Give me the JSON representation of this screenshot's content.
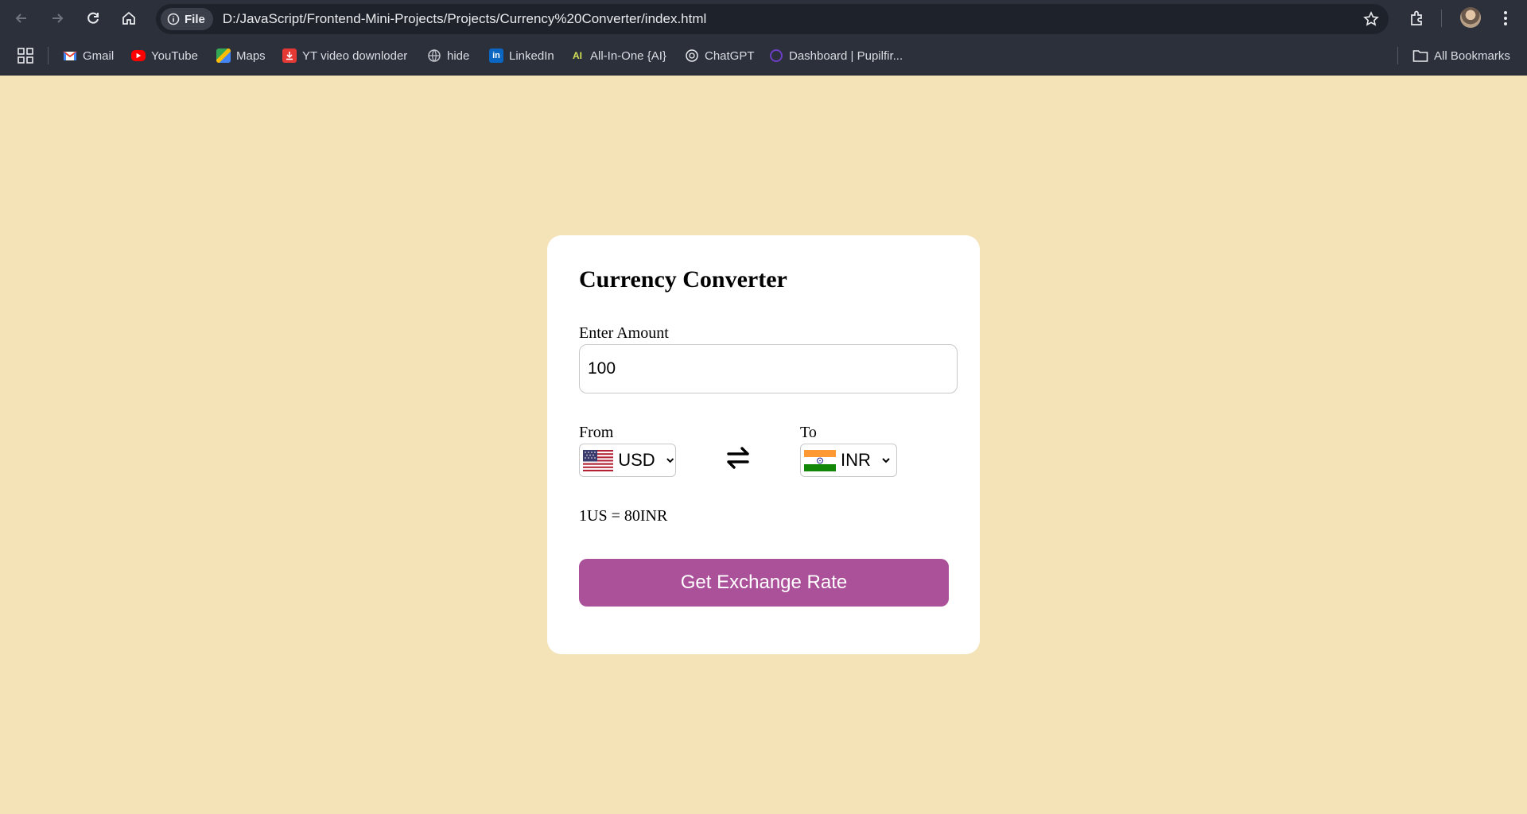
{
  "browser": {
    "url_scheme_label": "File",
    "url": "D:/JavaScript/Frontend-Mini-Projects/Projects/Currency%20Converter/index.html",
    "bookmarks": [
      {
        "label": "Gmail",
        "icon": "gmail-icon",
        "color": "#ea4335"
      },
      {
        "label": "YouTube",
        "icon": "youtube-icon",
        "color": "#ff0000"
      },
      {
        "label": "Maps",
        "icon": "maps-icon",
        "color": "#34a853"
      },
      {
        "label": "YT video downloder",
        "icon": "download-icon",
        "color": "#e53935"
      },
      {
        "label": "hide",
        "icon": "globe-icon",
        "color": "#9aa0a6"
      },
      {
        "label": "LinkedIn",
        "icon": "linkedin-icon",
        "color": "#0a66c2"
      },
      {
        "label": "All-In-One {AI}",
        "icon": "ai-icon",
        "color": "#d4e157"
      },
      {
        "label": "ChatGPT",
        "icon": "chatgpt-icon",
        "color": "#e8eaed"
      },
      {
        "label": "Dashboard | Pupilfir...",
        "icon": "pupilfirst-icon",
        "color": "#6c3fc5"
      }
    ],
    "all_bookmarks_label": "All Bookmarks"
  },
  "app": {
    "title": "Currency Converter",
    "amount_label": "Enter Amount",
    "amount_value": "100",
    "from_label": "From",
    "from_currency": "USD",
    "to_label": "To",
    "to_currency": "INR",
    "message": "1US = 80INR",
    "button_label": "Get Exchange Rate"
  },
  "colors": {
    "page_background": "#f3e3b7",
    "card_background": "#ffffff",
    "button": "#ab519a",
    "browser_chrome": "#2b303b"
  }
}
